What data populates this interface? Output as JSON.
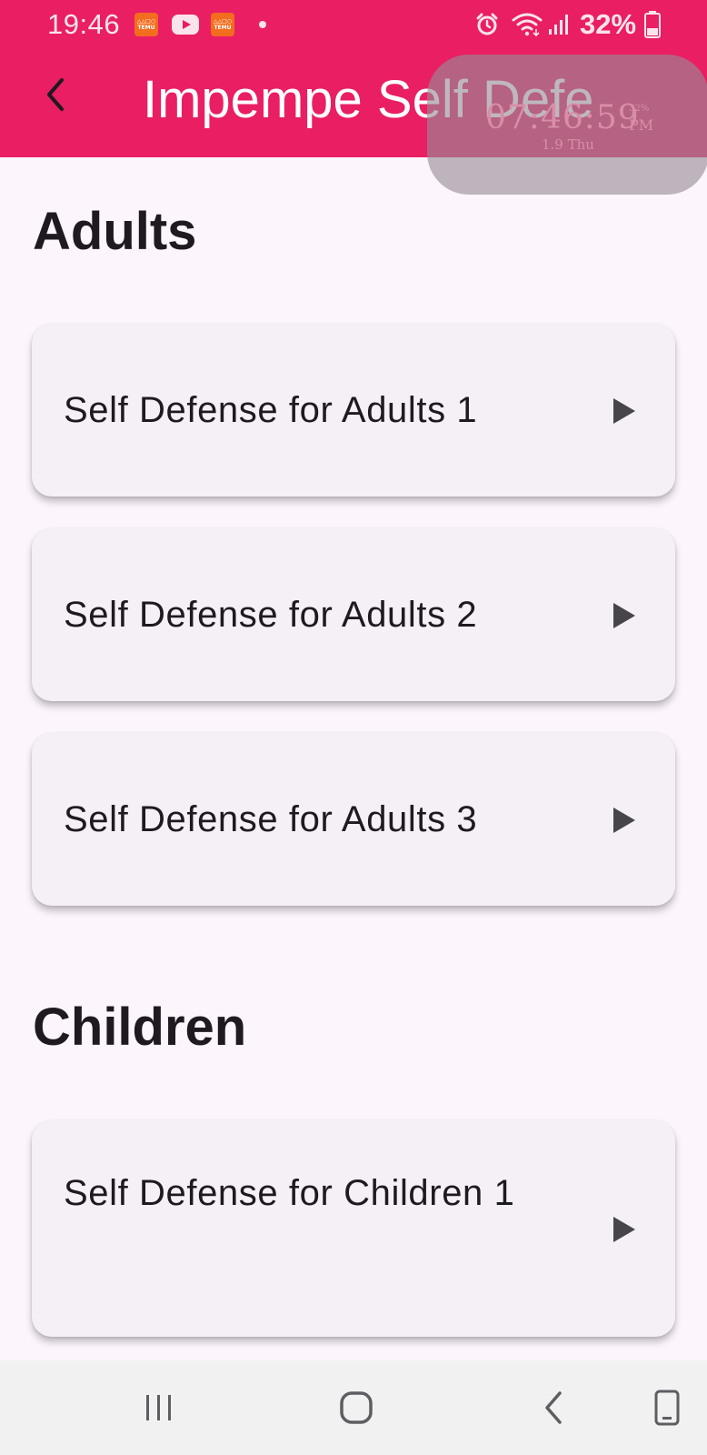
{
  "colors": {
    "primary": "#e91e63",
    "background": "#fcf5fc",
    "card": "#f5f0f6",
    "text": "#1e1a1f"
  },
  "status_bar": {
    "time": "19:46",
    "notifications": [
      "temu-icon",
      "youtube-icon",
      "temu-icon"
    ],
    "temu_badge": "TEMU",
    "battery": "32%"
  },
  "app_bar": {
    "title": "Impempe Self Defe",
    "back_icon": "chevron-left-icon"
  },
  "clock_overlay": {
    "time": "07:46:59",
    "ampm": "PM",
    "battery": "32%",
    "date": "1.9 Thu"
  },
  "sections": [
    {
      "title": "Adults",
      "items": [
        "Self Defense for Adults 1",
        "Self Defense for Adults 2",
        "Self Defense for Adults 3"
      ]
    },
    {
      "title": "Children",
      "items": [
        "Self Defense for Children 1"
      ]
    }
  ],
  "nav_bar": {
    "icons": [
      "recent-apps-icon",
      "home-icon",
      "back-icon",
      "keyboard-toggle-icon"
    ]
  }
}
